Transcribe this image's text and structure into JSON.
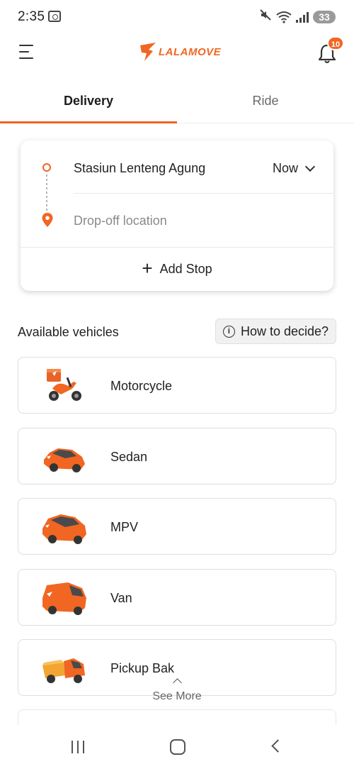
{
  "status_bar": {
    "time": "2:35",
    "battery": "33"
  },
  "header": {
    "logo_text": "LALAMOVE",
    "notification_count": "10",
    "brand_color": "#f16622"
  },
  "tabs": [
    {
      "label": "Delivery",
      "active": true
    },
    {
      "label": "Ride",
      "active": false
    }
  ],
  "route": {
    "pickup": "Stasiun Lenteng Agung",
    "time_option": "Now",
    "dropoff_placeholder": "Drop-off location",
    "add_stop_label": "Add Stop"
  },
  "vehicles_section": {
    "title": "Available vehicles",
    "how_to_decide_label": "How to decide?"
  },
  "vehicles": [
    {
      "name": "Motorcycle",
      "icon": "motorcycle-icon"
    },
    {
      "name": "Sedan",
      "icon": "sedan-icon"
    },
    {
      "name": "MPV",
      "icon": "mpv-icon"
    },
    {
      "name": "Van",
      "icon": "van-icon"
    },
    {
      "name": "Pickup Bak",
      "icon": "pickup-icon"
    }
  ],
  "see_more_label": "See More"
}
